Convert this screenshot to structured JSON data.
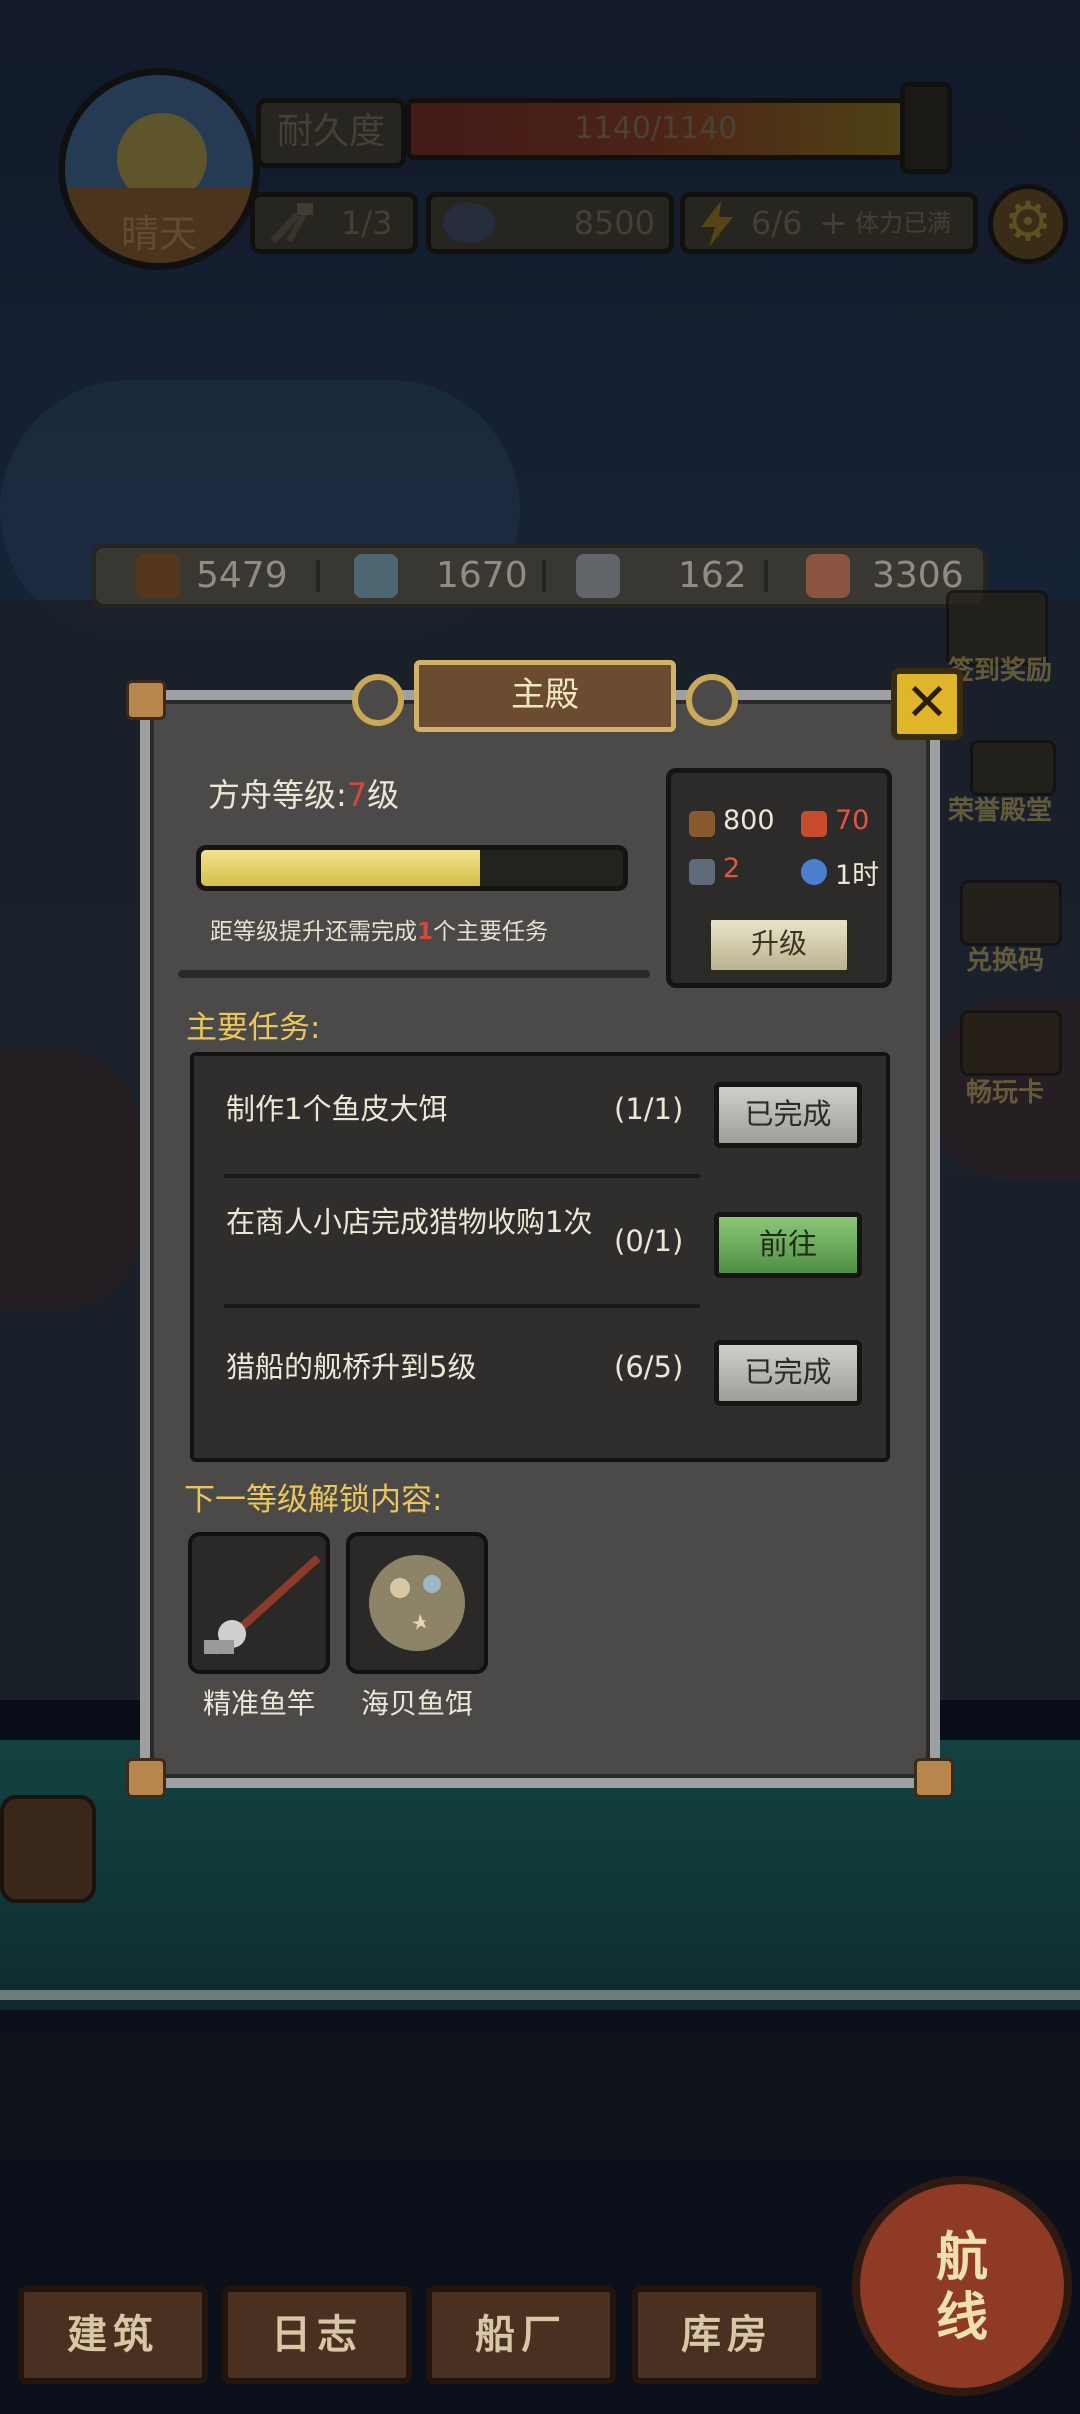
{
  "hud": {
    "weather_label": "晴天",
    "durability_label": "耐久度",
    "durability_value": "1140/1140",
    "repair_count": "1/3",
    "coins": "8500",
    "energy": "6/6",
    "energy_status": "体力已满",
    "icons": [
      "wrench-hammer-icon",
      "gear-icon",
      "lightning-icon",
      "plus-icon"
    ]
  },
  "resources": [
    {
      "icon": "wood-log-icon",
      "value": "5479"
    },
    {
      "icon": "water-bucket-icon",
      "value": "1670"
    },
    {
      "icon": "iron-ingot-icon",
      "value": "162"
    },
    {
      "icon": "fish-meat-icon",
      "value": "3306"
    }
  ],
  "side_buttons": {
    "checkin": "签到奖励",
    "honor": "荣誉殿堂",
    "redeem": "兑换码",
    "pass": "畅玩卡"
  },
  "panel": {
    "title": "主殿",
    "ark_level_prefix": "方舟等级:",
    "ark_level_value": "7",
    "ark_level_suffix": "级",
    "progress_fraction": 0.66,
    "req_prefix": "距等级提升还需完成",
    "req_count": "1",
    "req_suffix": "个主要任务",
    "cost": {
      "wood": "800",
      "meat": "70",
      "ore": "2",
      "time": "1时"
    },
    "upgrade_label": "升级",
    "tasks_title": "主要任务:",
    "tasks": [
      {
        "name": "制作1个鱼皮大饵",
        "progress": "(1/1)",
        "button": "已完成",
        "state": "done"
      },
      {
        "name": "在商人小店完成猎物收购1次",
        "progress": "(0/1)",
        "button": "前往",
        "state": "go"
      },
      {
        "name": "猎船的舰桥升到5级",
        "progress": "(6/5)",
        "button": "已完成",
        "state": "done"
      }
    ],
    "unlock_title": "下一等级解锁内容:",
    "unlocks": [
      {
        "name": "精准鱼竿",
        "icon": "fishing-rod-icon"
      },
      {
        "name": "海贝鱼饵",
        "icon": "shell-bait-icon"
      }
    ]
  },
  "nav": {
    "build": "建筑",
    "log": "日志",
    "shipyard": "船厂",
    "storage": "库房",
    "route_line1": "航",
    "route_line2": "线"
  },
  "colors": {
    "accent_red": "#d04a3c",
    "accent_gold": "#e9c75c",
    "go_green": "#5f9d52"
  }
}
